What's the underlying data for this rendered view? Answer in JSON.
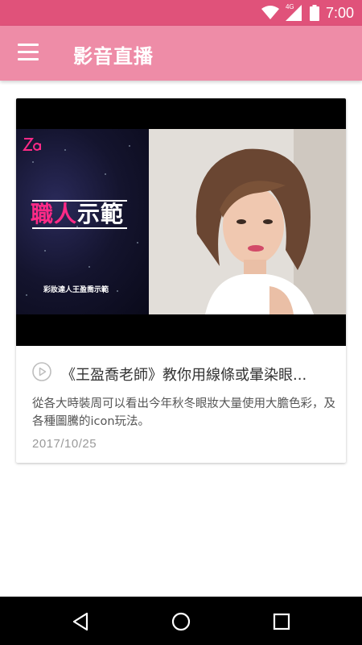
{
  "status_bar": {
    "time": "7:00",
    "network_label": "4G",
    "icons": [
      "wifi-icon",
      "signal-icon",
      "battery-icon"
    ]
  },
  "app_bar": {
    "title": "影音直播",
    "menu_icon": "hamburger-menu-icon"
  },
  "video_card": {
    "thumbnail": {
      "logo_text": "Za",
      "promo_title_pink": "職人",
      "promo_title_white": "示範",
      "promo_subtitle": "彩妝達人王盈喬示範"
    },
    "title": "《王盈喬老師》教你用線條或暈染眼...",
    "description": "從各大時裝周可以看出今年秋冬眼妝大量使用大膽色彩，及各種圖騰的icon玩法。",
    "date": "2017/10/25",
    "play_icon": "play-circle-icon"
  },
  "nav_bar": {
    "icons": [
      "back-icon",
      "home-icon",
      "recents-icon"
    ]
  },
  "colors": {
    "status_bar": "#e0527a",
    "app_bar": "#ee8ca7",
    "promo_pink": "#ff2a86"
  }
}
